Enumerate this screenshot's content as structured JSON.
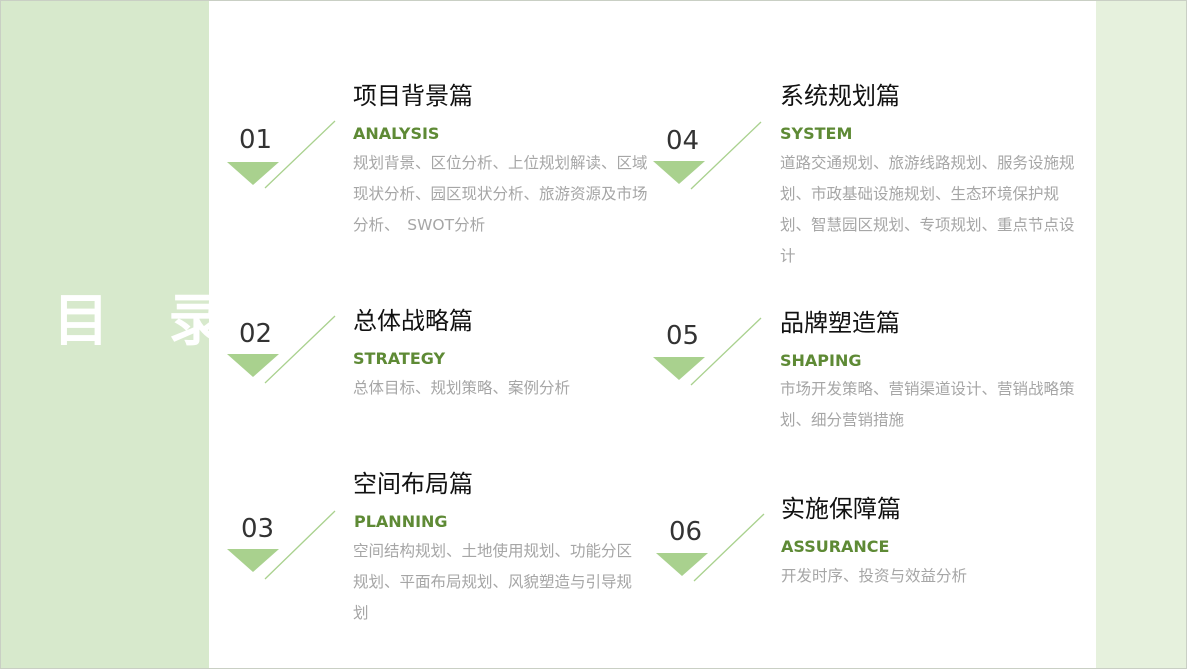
{
  "title": "目 录",
  "sections": [
    {
      "number": "01",
      "title": "项目背景篇",
      "subtitle": "ANALYSIS",
      "description": "规划背景、区位分析、上位规划解读、区域现状分析、园区现状分析、旅游资源及市场分析、　SWOT分析"
    },
    {
      "number": "02",
      "title": "总体战略篇",
      "subtitle": "STRATEGY",
      "description": "总体目标、规划策略、案例分析"
    },
    {
      "number": "03",
      "title": "空间布局篇",
      "subtitle": "PLANNING",
      "description": "空间结构规划、土地使用规划、功能分区规划、平面布局规划、风貌塑造与引导规划"
    },
    {
      "number": "04",
      "title": "系统规划篇",
      "subtitle": "SYSTEM",
      "description": "道路交通规划、旅游线路规划、服务设施规划、市政基础设施规划、生态环境保护规划、智慧园区规划、专项规划、重点节点设计"
    },
    {
      "number": "05",
      "title": "品牌塑造篇",
      "subtitle": "SHAPING",
      "description": "市场开发策略、营销渠道设计、营销战略策划、细分营销措施"
    },
    {
      "number": "06",
      "title": "实施保障篇",
      "subtitle": "ASSURANCE",
      "description": "开发时序、投资与效益分析"
    }
  ],
  "colors": {
    "left_band": "#d7e9cc",
    "right_band": "#e6f1dd",
    "accent_green": "#5e8a35",
    "marker_green": "#a9d18e",
    "description_gray": "#a6a6a6"
  }
}
